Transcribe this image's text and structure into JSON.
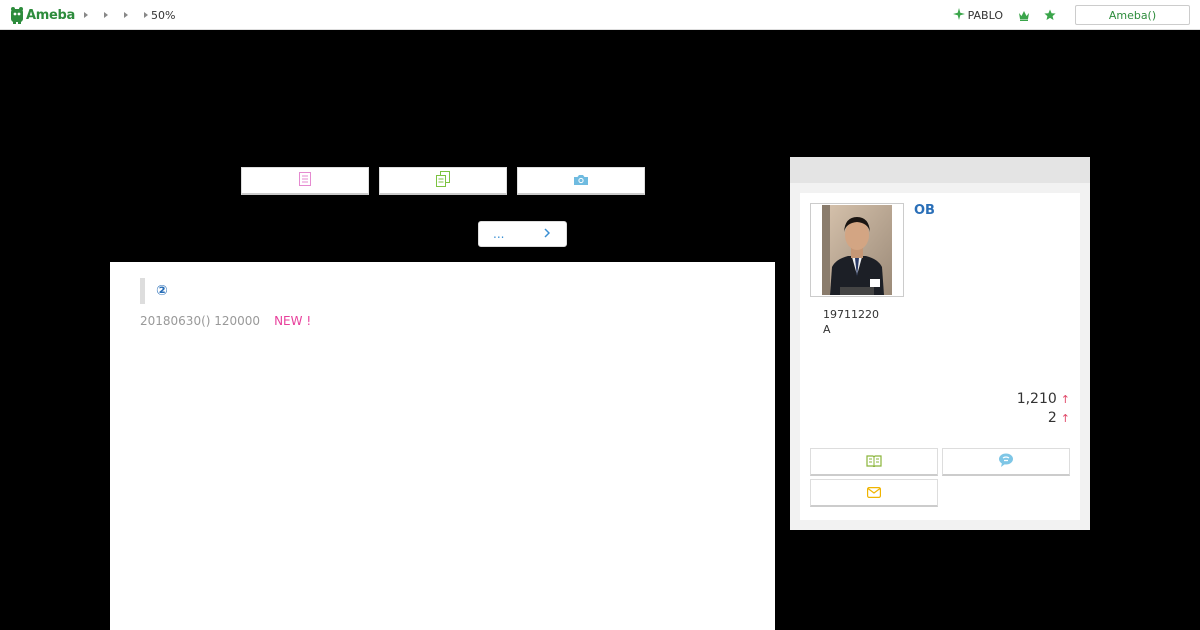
{
  "header": {
    "logo_text": "Ameba",
    "zoom_label": "50%",
    "pablo_label": "PABLO",
    "login_label": "Ameba()"
  },
  "nav": {
    "more_label": "..."
  },
  "entry": {
    "title": "②",
    "date": "20180630() 120000",
    "new_label": "NEW !"
  },
  "profile": {
    "name": "OB",
    "info_line1": "19711220",
    "info_line2": "A",
    "stat1": "1,210",
    "stat2": "2",
    "arrow": "↑"
  },
  "colors": {
    "brand_green": "#2d8c3c",
    "link_blue": "#2a6fb8",
    "new_pink": "#e8409c",
    "stat_arrow": "#e04868"
  },
  "icons": {
    "entries_icon": "document-icon",
    "copy_icon": "copy-icon",
    "photo_icon": "camera-icon",
    "reader_icon": "book-icon",
    "message_icon": "chat-icon",
    "mail_icon": "mail-icon"
  }
}
